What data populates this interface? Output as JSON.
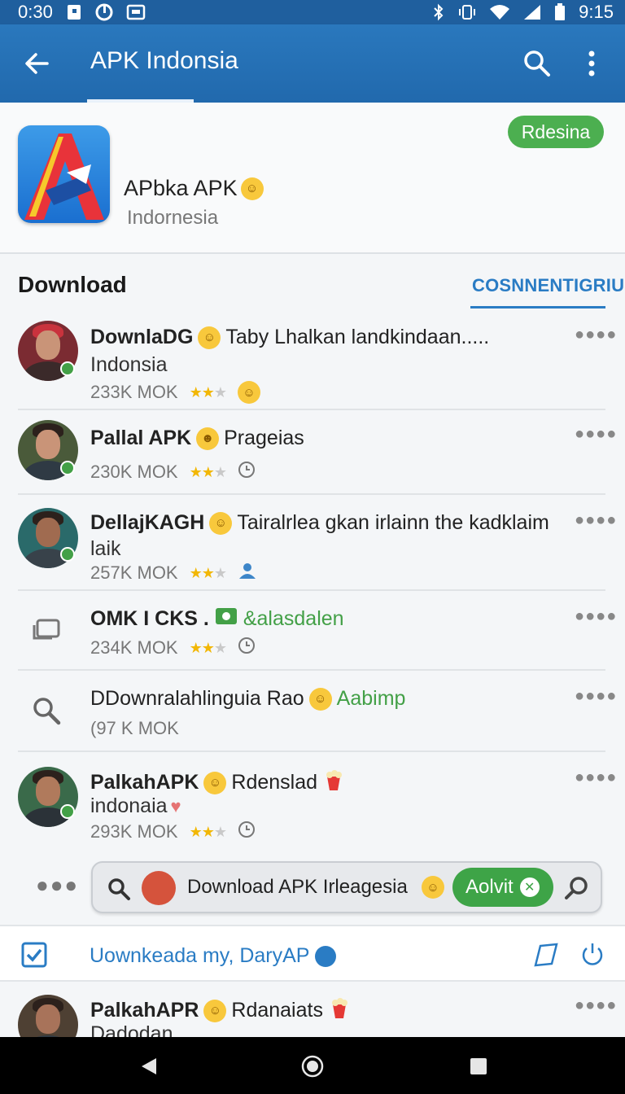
{
  "status_bar": {
    "time_left": "0:30",
    "time_right": "9:15"
  },
  "app_bar": {
    "title": "APK Indonsia"
  },
  "app_header": {
    "name": "APbka APK",
    "country": "Indornesia",
    "region_badge": "Rdesina"
  },
  "section": {
    "title": "Download",
    "tab": "COSNNENTIGRIU"
  },
  "rows": [
    {
      "title": "DownlaDG",
      "text": "Taby Lhalkan landkindaan.....",
      "sub": "Indonsia",
      "meta": "233K MOK",
      "rating": 2
    },
    {
      "title": "Pallal APK",
      "text": "Prageias",
      "sub": "",
      "meta": "230K MOK",
      "rating": 2
    },
    {
      "title": "DellajKAGH",
      "text": "Tairalrlea gkan irlainn the kadklaim",
      "sub": "laik",
      "meta": "257K MOK",
      "rating": 1.5
    },
    {
      "title": "OMK I CKS .",
      "text": "&alasdalen",
      "sub": "",
      "meta": "234K MOK",
      "rating": 1.5
    },
    {
      "title": "DDownralahlinguia Rao",
      "text": "Aabimp",
      "sub": "",
      "meta": "(97 K MOK",
      "rating": 0
    },
    {
      "title": "PalkahAPK",
      "text": "Rdenslad",
      "sub": "indonaia",
      "meta": "293K MOK",
      "rating": 2
    },
    {
      "title": "PalkahAPR",
      "text": "Rdanaiats",
      "sub": "Dadodan",
      "meta": "",
      "rating": 0
    }
  ],
  "search_bar": {
    "text": "Download APK Irleagesia",
    "chip": "Aolvit"
  },
  "action_bar": {
    "text": "Uownkeada my, DaryAP"
  },
  "icons": {
    "status": [
      "sim-icon",
      "vpn-icon",
      "screenshot-icon",
      "bluetooth-icon",
      "vibrate-icon",
      "wifi-icon",
      "signal-icon",
      "battery-icon"
    ],
    "app_bar": [
      "back-arrow-icon",
      "search-icon",
      "more-vert-icon"
    ],
    "nav": [
      "back-nav-icon",
      "home-nav-icon",
      "recents-nav-icon"
    ]
  },
  "colors": {
    "primary": "#2169ad",
    "accent": "#2a7cc4",
    "green": "#43a047",
    "star": "#f2b705"
  }
}
